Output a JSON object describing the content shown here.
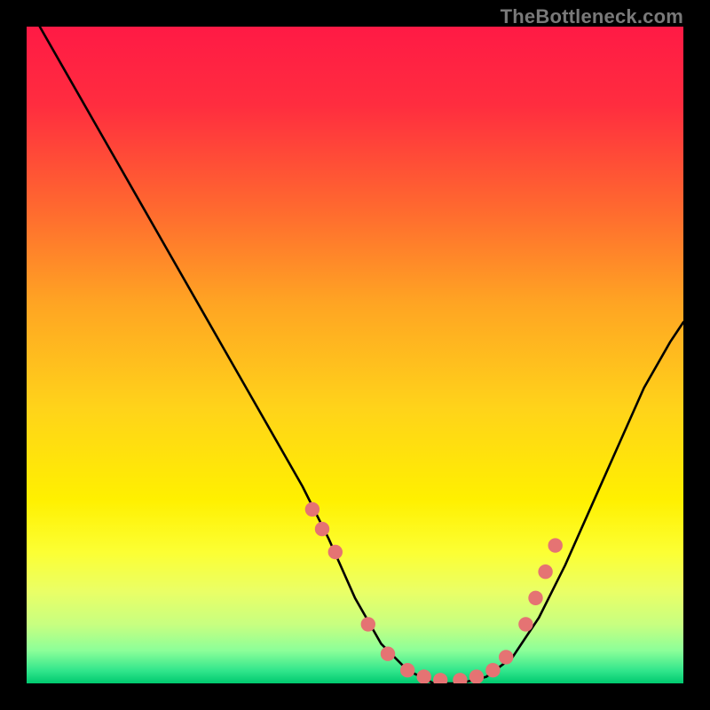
{
  "watermark": "TheBottleneck.com",
  "colors": {
    "background": "#000000",
    "curve": "#000000",
    "marker_fill": "#e57373",
    "marker_stroke": "#c75a5a"
  },
  "chart_data": {
    "type": "line",
    "title": "",
    "xlabel": "",
    "ylabel": "",
    "xlim": [
      0,
      100
    ],
    "ylim": [
      0,
      100
    ],
    "gradient_stops": [
      {
        "offset": 0.0,
        "color": "#ff1a45"
      },
      {
        "offset": 0.12,
        "color": "#ff2d3f"
      },
      {
        "offset": 0.28,
        "color": "#ff6a2f"
      },
      {
        "offset": 0.42,
        "color": "#ffa423"
      },
      {
        "offset": 0.58,
        "color": "#ffd31a"
      },
      {
        "offset": 0.72,
        "color": "#fff000"
      },
      {
        "offset": 0.8,
        "color": "#fcff33"
      },
      {
        "offset": 0.86,
        "color": "#eaff66"
      },
      {
        "offset": 0.91,
        "color": "#c8ff80"
      },
      {
        "offset": 0.95,
        "color": "#8cff99"
      },
      {
        "offset": 0.98,
        "color": "#33e68c"
      },
      {
        "offset": 1.0,
        "color": "#00c96f"
      }
    ],
    "series": [
      {
        "name": "bottleneck-curve",
        "x": [
          2,
          6,
          10,
          14,
          18,
          22,
          26,
          30,
          34,
          38,
          42,
          46,
          50,
          54,
          58,
          62,
          66,
          70,
          74,
          78,
          82,
          86,
          90,
          94,
          98,
          100
        ],
        "y": [
          100,
          93,
          86,
          79,
          72,
          65,
          58,
          51,
          44,
          37,
          30,
          22,
          13,
          6,
          2,
          0,
          0,
          1,
          4,
          10,
          18,
          27,
          36,
          45,
          52,
          55
        ]
      }
    ],
    "markers": {
      "name": "sample-points",
      "x": [
        43.5,
        45.0,
        47.0,
        52.0,
        55.0,
        58.0,
        60.5,
        63.0,
        66.0,
        68.5,
        71.0,
        73.0,
        76.0,
        77.5,
        79.0,
        80.5
      ],
      "y": [
        26.5,
        23.5,
        20.0,
        9.0,
        4.5,
        2.0,
        1.0,
        0.5,
        0.5,
        1.0,
        2.0,
        4.0,
        9.0,
        13.0,
        17.0,
        21.0
      ]
    }
  }
}
